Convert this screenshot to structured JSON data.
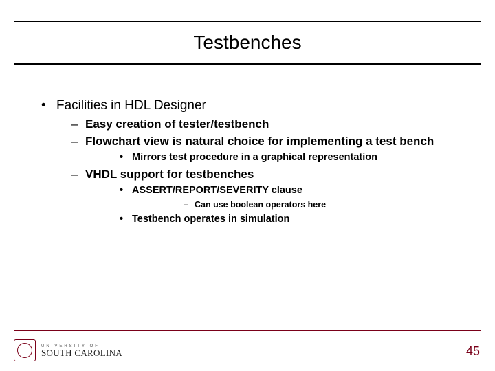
{
  "title": "Testbenches",
  "page_number": "45",
  "logo": {
    "top": "UNIVERSITY OF",
    "main": "SOUTH CAROLINA"
  },
  "b": {
    "l1_0": "Facilities in HDL Designer",
    "l2_0": "Easy creation of tester/testbench",
    "l2_1": "Flowchart view is natural choice for implementing a test bench",
    "l3_0": "Mirrors test procedure in a graphical representation",
    "l2_2": "VHDL support for testbenches",
    "l3_1": "ASSERT/REPORT/SEVERITY clause",
    "l4_0": "Can use boolean operators here",
    "l3_2": "Testbench operates in simulation"
  }
}
